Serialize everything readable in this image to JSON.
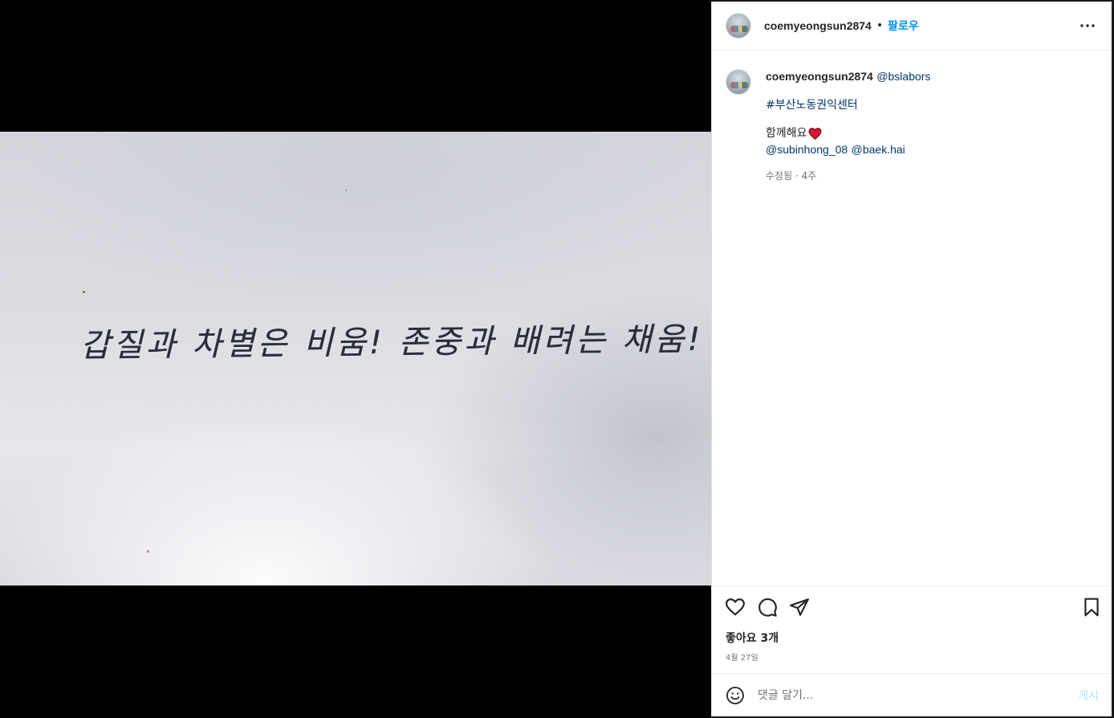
{
  "media": {
    "handwritten_text": "갑질과 차별은 비움! 존중과 배려는 채움!"
  },
  "header": {
    "username": "coemyeongsun2874",
    "separator": "•",
    "follow_label": "팔로우"
  },
  "caption": {
    "username": "coemyeongsun2874",
    "mention": "@bslabors",
    "hashtag": "#부산노동권익센터",
    "together_text": "함께해요",
    "mention_1": "@subinhong_08",
    "mention_2": "@baek.hai",
    "meta": "수정됨 · 4주"
  },
  "footer": {
    "likes": "좋아요 3개",
    "date": "4월 27일"
  },
  "comment": {
    "placeholder": "댓글 달기...",
    "post_label": "게시"
  },
  "colors": {
    "link": "#00376b",
    "follow": "#0095f6",
    "post_disabled": "#b2dffc",
    "heart": "#e0245e"
  }
}
